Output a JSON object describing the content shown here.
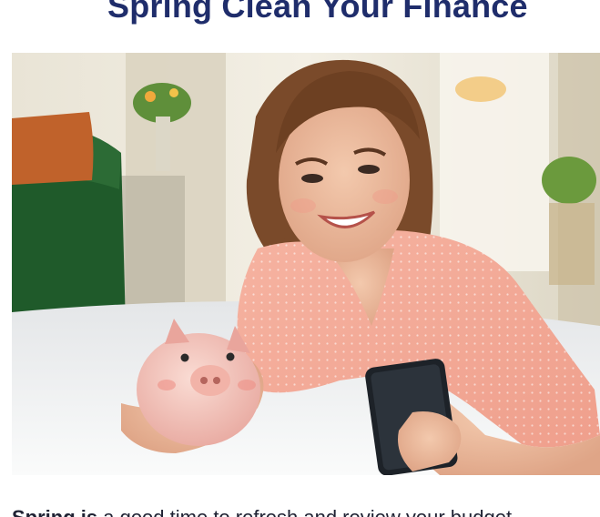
{
  "article": {
    "headline": "Spring Clean Your Finance",
    "photo_alt": "Smiling woman lying on a white rug holding a piggy bank and a smartphone",
    "body_lead": "Spring is",
    "body_rest": " a good time to refresh and review your budget"
  },
  "colors": {
    "headline": "#1f2d6b",
    "body_text": "#1f2233",
    "background": "#ffffff"
  }
}
